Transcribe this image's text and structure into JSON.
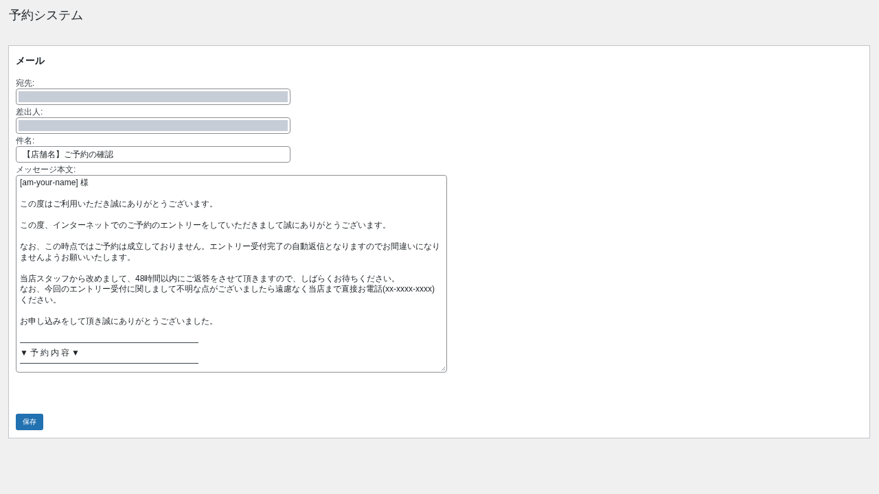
{
  "app_title": "予約システム",
  "panel": {
    "heading": "メール",
    "fields": [
      {
        "label": "宛先:",
        "kind": "input",
        "redacted": true
      },
      {
        "label": "差出人:",
        "kind": "input",
        "redacted": true
      },
      {
        "label": "件名:",
        "kind": "input",
        "redacted": false,
        "value": "【店舗名】ご予約の確認"
      },
      {
        "label": "メッセージ本文:",
        "kind": "textarea",
        "lines": [
          {
            "kind": "text",
            "text": "[am-your-name] 様"
          },
          {
            "kind": "blank"
          },
          {
            "kind": "text",
            "text": "この度はご利用いただき誠にありがとうございます。"
          },
          {
            "kind": "blank"
          },
          {
            "kind": "text",
            "text": "この度、インターネットでのご予約のエントリーをしていただきまして誠にありがとうございます。"
          },
          {
            "kind": "blank"
          },
          {
            "kind": "text",
            "text": "なお、この時点ではご予約は成立しておりません。エントリー受付完了の自動返信となりますのでお間違いになり"
          },
          {
            "kind": "text",
            "text": "ませんようお願いいたします。"
          },
          {
            "kind": "blank"
          },
          {
            "kind": "text",
            "text": "当店スタッフから改めまして、48時間以内にご返答をさせて頂きますので、しばらくお待ちください。"
          },
          {
            "kind": "text",
            "text": "なお、今回のエントリー受付に関しまして不明な点がございましたら遠慮なく当店まで直接お電話(xx-xxxx-xxxx)"
          },
          {
            "kind": "text",
            "text": "ください。"
          },
          {
            "kind": "blank"
          },
          {
            "kind": "text",
            "text": "お申し込みをして頂き誠にありがとうございました。"
          },
          {
            "kind": "blank"
          },
          {
            "kind": "rule"
          },
          {
            "kind": "text",
            "text": "▼予約内容▼",
            "spaced": true
          },
          {
            "kind": "rule"
          }
        ]
      }
    ],
    "save_button": "保存"
  }
}
